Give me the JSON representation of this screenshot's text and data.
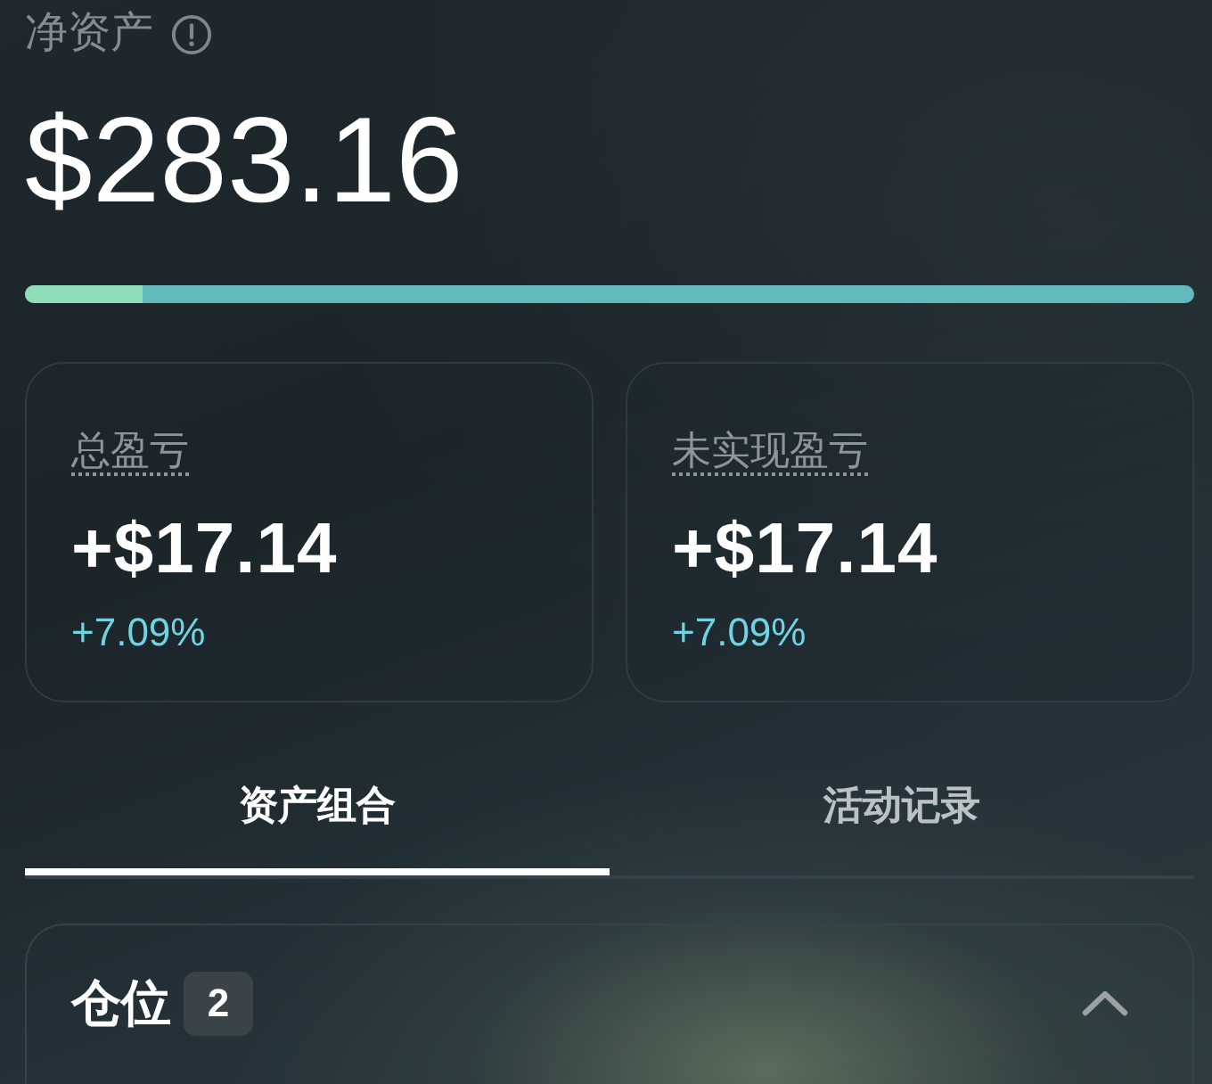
{
  "header": {
    "title": "净资产",
    "value": "$283.16"
  },
  "allocation_bar": {
    "level": 0.1
  },
  "stats": [
    {
      "label": "总盈亏",
      "value": "+$17.14",
      "change": "+7.09%"
    },
    {
      "label": "未实现盈亏",
      "value": "+$17.14",
      "change": "+7.09%"
    }
  ],
  "tabs": [
    {
      "label": "资产组合",
      "selected": true
    },
    {
      "label": "活动记录",
      "selected": false
    }
  ],
  "positions": {
    "title": "仓位",
    "count": "2",
    "expanded": true
  }
}
